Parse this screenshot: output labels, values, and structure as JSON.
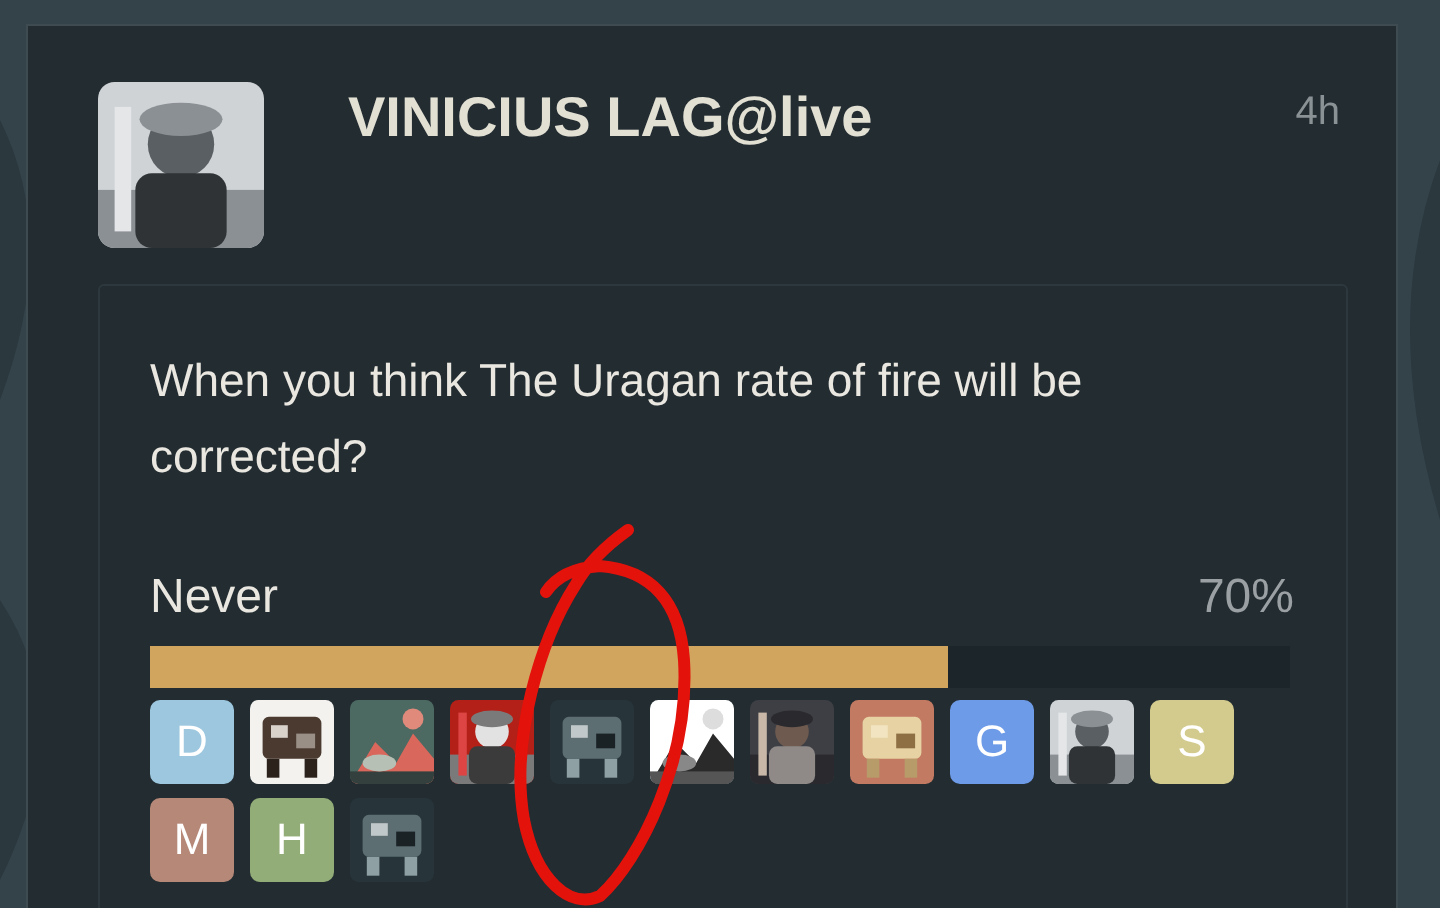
{
  "post": {
    "author": "VINICIUS LAG@live",
    "time": "4h",
    "avatar": {
      "kind": "picture"
    }
  },
  "poll": {
    "question": "When you think The Uragan rate of fire will be corrected?",
    "options": [
      {
        "label": "Never",
        "percent": "70%",
        "level": 0.7,
        "voters": [
          {
            "kind": "letter",
            "letter": "D",
            "color": "#9cc7df"
          },
          {
            "kind": "picture"
          },
          {
            "kind": "picture"
          },
          {
            "kind": "picture"
          },
          {
            "kind": "picture"
          },
          {
            "kind": "picture"
          },
          {
            "kind": "picture"
          },
          {
            "kind": "picture"
          },
          {
            "kind": "letter",
            "letter": "G",
            "color": "#6e9be8"
          },
          {
            "kind": "picture"
          },
          {
            "kind": "letter",
            "letter": "S",
            "color": "#d3cb8d"
          },
          {
            "kind": "letter",
            "letter": "M",
            "color": "#b68877"
          },
          {
            "kind": "letter",
            "letter": "H",
            "color": "#93ad78"
          },
          {
            "kind": "picture"
          }
        ]
      }
    ]
  },
  "annotation": {
    "kind": "ellipse"
  }
}
